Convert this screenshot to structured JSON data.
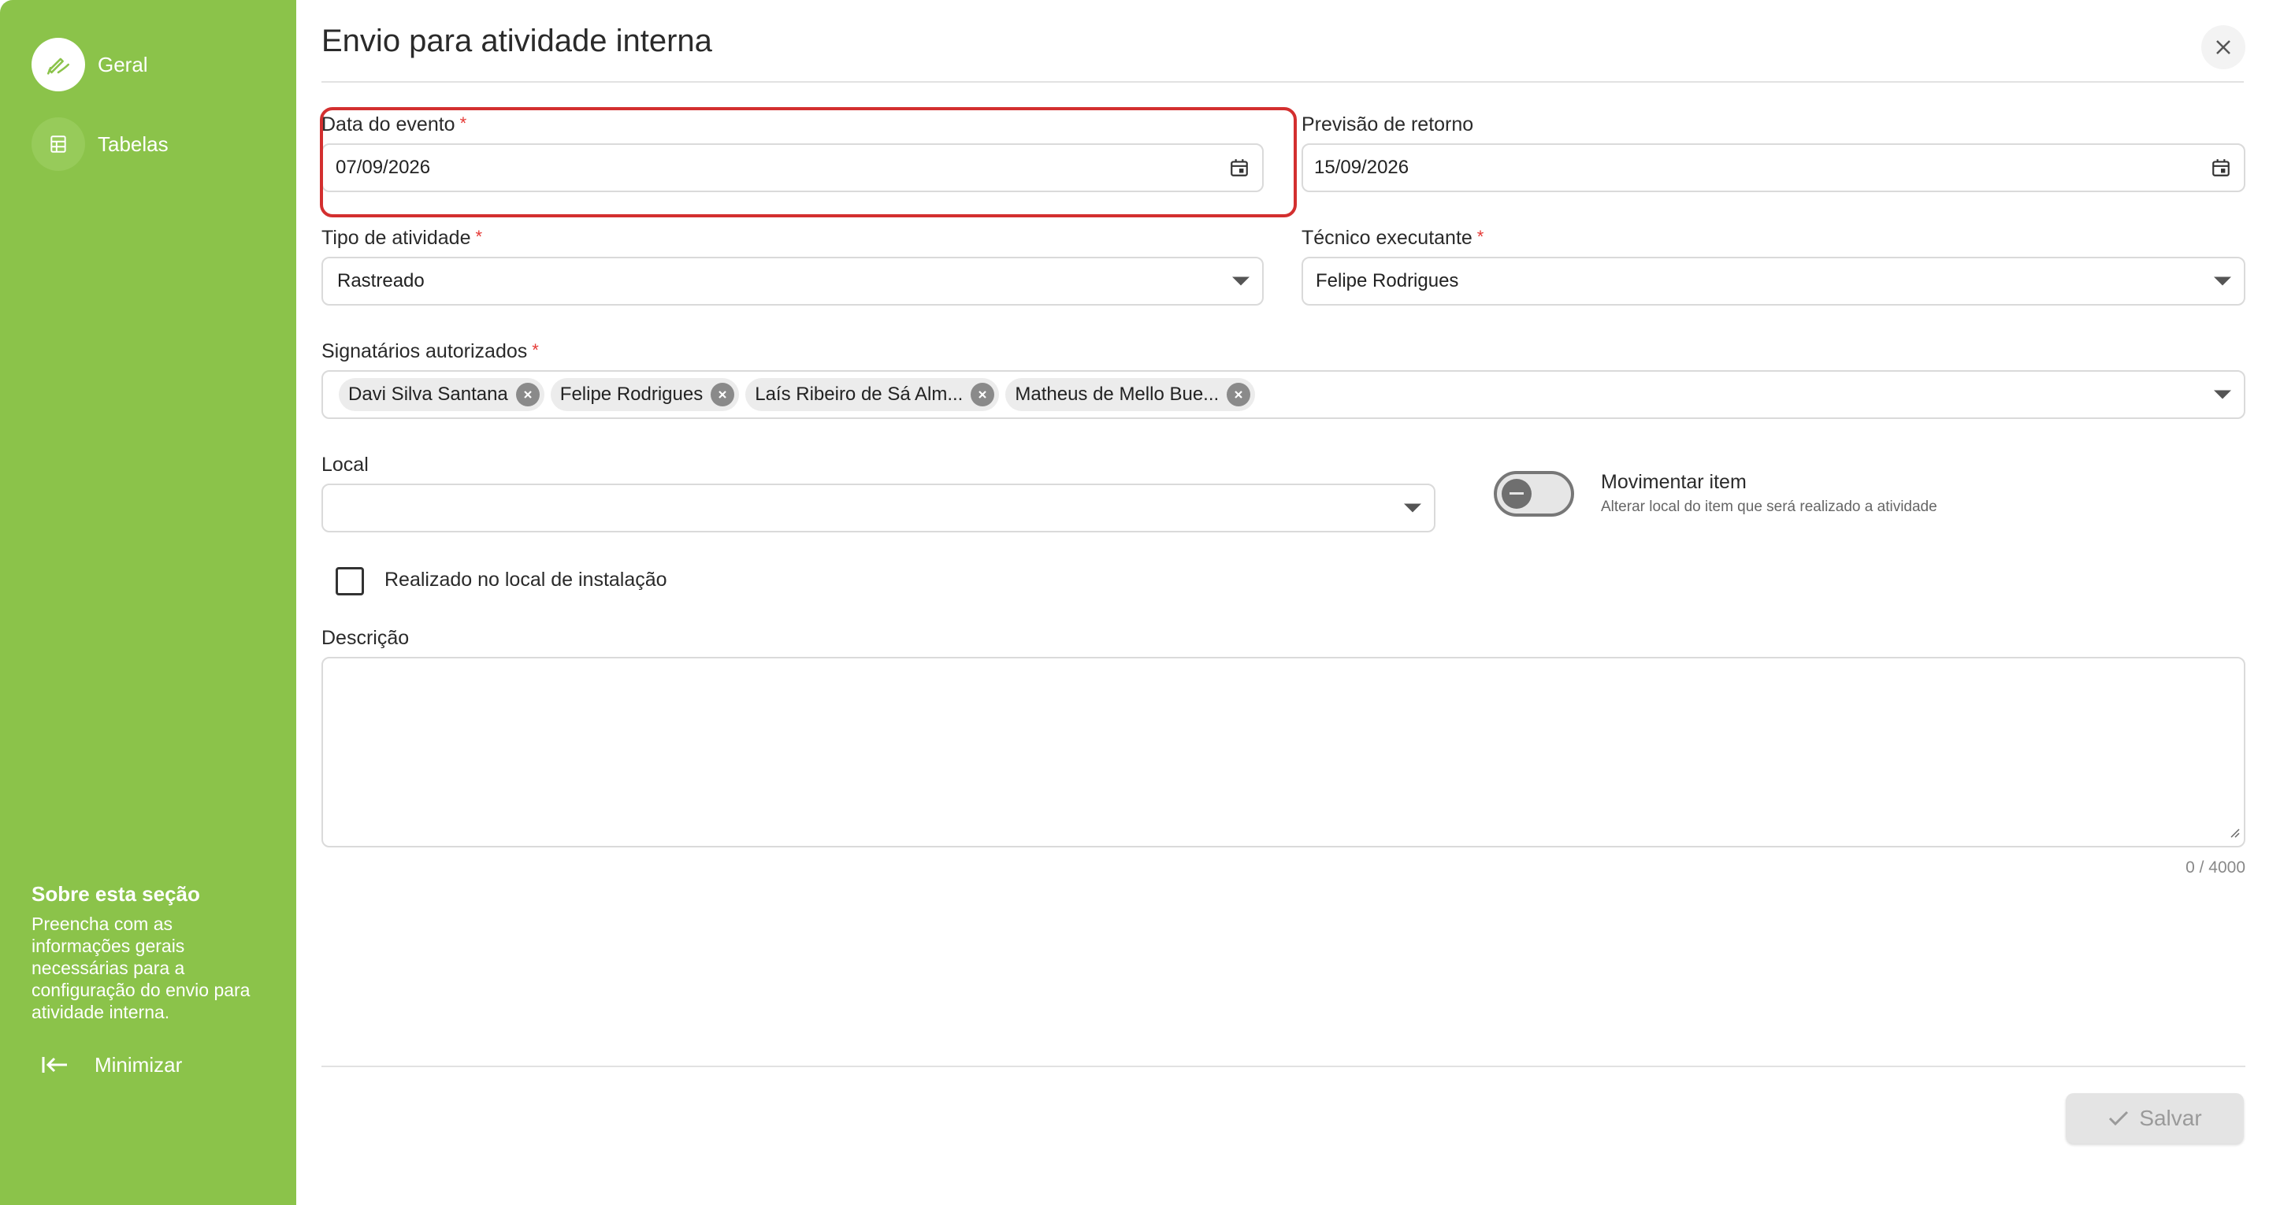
{
  "sidebar": {
    "items": [
      {
        "label": "Geral",
        "icon": "edit-pen-icon",
        "active": true
      },
      {
        "label": "Tabelas",
        "icon": "table-list-icon",
        "active": false
      }
    ],
    "about": {
      "title": "Sobre esta seção",
      "text": "Preencha com as informações gerais necessárias para a configuração do envio para atividade interna."
    },
    "minimize_label": "Minimizar"
  },
  "dialog": {
    "title": "Envio para atividade interna"
  },
  "form": {
    "data_evento": {
      "label": "Data do evento",
      "required": "*",
      "value": "07/09/2026"
    },
    "previsao_retorno": {
      "label": "Previsão de retorno",
      "value": "15/09/2026"
    },
    "tipo_atividade": {
      "label": "Tipo de atividade",
      "required": "*",
      "value": "Rastreado"
    },
    "tecnico": {
      "label": "Técnico executante",
      "required": "*",
      "value": "Felipe Rodrigues"
    },
    "signatarios": {
      "label": "Signatários autorizados",
      "required": "*",
      "chips": [
        "Davi Silva Santana",
        "Felipe Rodrigues",
        "Laís Ribeiro de Sá Alm...",
        "Matheus de Mello Bue..."
      ]
    },
    "local": {
      "label": "Local",
      "value": ""
    },
    "movimentar": {
      "title": "Movimentar item",
      "subtitle": "Alterar local do item que será realizado a atividade"
    },
    "realizado": {
      "label": "Realizado no local de instalação",
      "checked": false
    },
    "descricao": {
      "label": "Descrição",
      "value": "",
      "counter": "0 / 4000"
    }
  },
  "actions": {
    "save_label": "Salvar"
  },
  "colors": {
    "sidebar": "#8bc34a",
    "required": "#e53935",
    "highlight": "#d32f2f"
  }
}
